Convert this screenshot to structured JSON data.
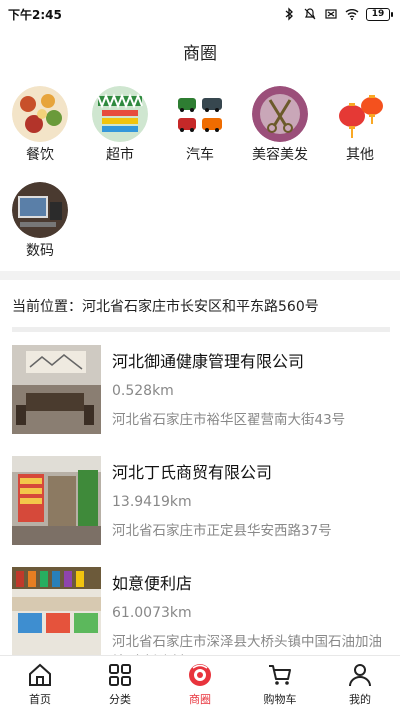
{
  "status_bar": {
    "time": "下午2:45",
    "battery": "19"
  },
  "page": {
    "title": "商圈"
  },
  "categories": [
    {
      "label": "餐饮",
      "icon": "food-icon"
    },
    {
      "label": "超市",
      "icon": "supermarket-icon"
    },
    {
      "label": "汽车",
      "icon": "car-icon"
    },
    {
      "label": "美容美发",
      "icon": "scissors-icon"
    },
    {
      "label": "其他",
      "icon": "lantern-icon"
    },
    {
      "label": "数码",
      "icon": "computer-icon"
    }
  ],
  "location": {
    "text": "当前位置：河北省石家庄市长安区和平东路560号"
  },
  "stores": [
    {
      "name": "河北御通健康管理有限公司",
      "distance": "0.528km",
      "address": "河北省石家庄市裕华区翟营南大街43号"
    },
    {
      "name": "河北丁氏商贸有限公司",
      "distance": "13.9419km",
      "address": "河北省石家庄市正定县华安西路37号"
    },
    {
      "name": "如意便利店",
      "distance": "61.0073km",
      "address": "河北省石家庄市深泽县大桥头镇中国石油加油站(大桥头村)"
    }
  ],
  "nav": [
    {
      "label": "首页",
      "icon": "home-icon"
    },
    {
      "label": "分类",
      "icon": "grid-icon"
    },
    {
      "label": "商圈",
      "icon": "circle-logo-icon",
      "active": true
    },
    {
      "label": "购物车",
      "icon": "cart-icon"
    },
    {
      "label": "我的",
      "icon": "user-icon"
    }
  ],
  "colors": {
    "accent": "#e8343d",
    "text": "#222222",
    "muted": "#888888"
  }
}
